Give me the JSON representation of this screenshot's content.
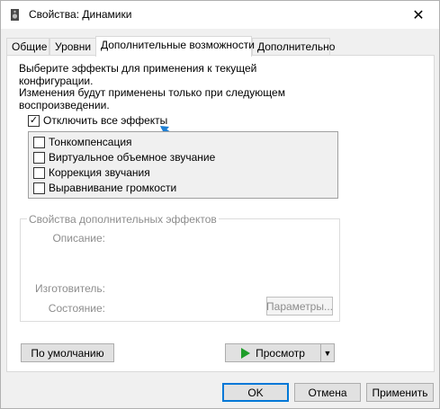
{
  "window": {
    "title": "Свойства: Динамики",
    "close_glyph": "✕"
  },
  "tabs": [
    {
      "label": "Общие"
    },
    {
      "label": "Уровни"
    },
    {
      "label": "Дополнительные возможности"
    },
    {
      "label": "Дополнительно"
    }
  ],
  "panel": {
    "description_line1": "Выберите эффекты для применения к текущей конфигурации.",
    "description_line2": "Изменения будут применены только при следующем",
    "description_line3": "воспроизведении.",
    "disable_all": {
      "label": "Отключить все эффекты",
      "checked": true
    },
    "effects": [
      {
        "label": "Тонкомпенсация",
        "checked": false
      },
      {
        "label": "Виртуальное объемное звучание",
        "checked": false
      },
      {
        "label": "Коррекция звучания",
        "checked": false
      },
      {
        "label": "Выравнивание громкости",
        "checked": false
      }
    ],
    "properties": {
      "title": "Свойства дополнительных эффектов",
      "description_label": "Описание:",
      "vendor_label": "Изготовитель:",
      "state_label": "Состояние:",
      "settings_button": "Параметры..."
    },
    "defaults_button": "По умолчанию",
    "preview_button": "Просмотр",
    "preview_dropdown_glyph": "▼"
  },
  "footer": {
    "ok": "OK",
    "cancel": "Отмена",
    "apply": "Применить"
  },
  "colors": {
    "accent": "#0078d7",
    "play": "#1f9d2a",
    "arrow": "#1e7fd4"
  }
}
